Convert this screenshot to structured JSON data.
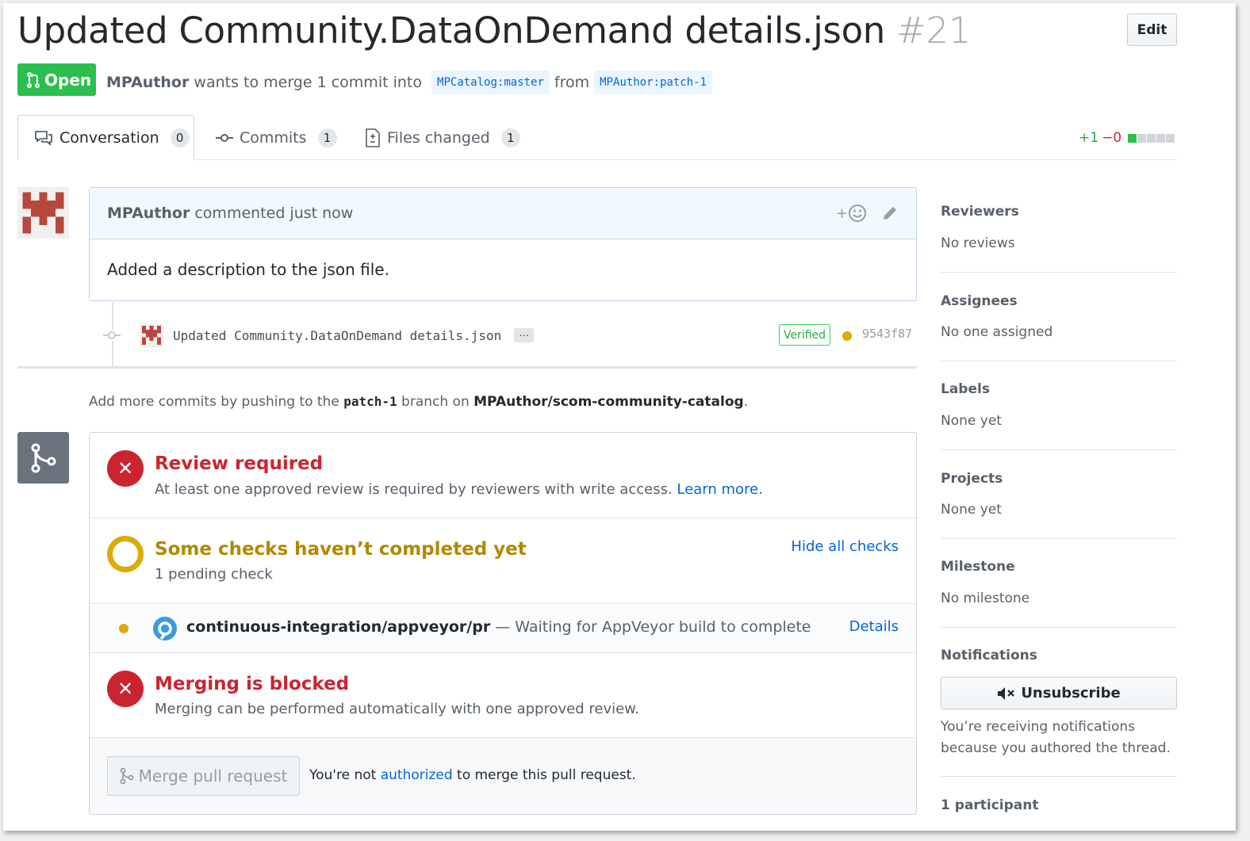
{
  "pr": {
    "title": "Updated Community.DataOnDemand details.json",
    "number": "#21",
    "edit_label": "Edit",
    "state_label": "Open",
    "author": "MPAuthor",
    "merge_text": "wants to merge 1 commit into",
    "base_branch": "MPCatalog:master",
    "from_text": "from",
    "head_branch": "MPAuthor:patch-1"
  },
  "tabs": [
    {
      "label": "Conversation",
      "count": "0",
      "icon": "comment-discussion-icon"
    },
    {
      "label": "Commits",
      "count": "1",
      "icon": "git-commit-icon"
    },
    {
      "label": "Files changed",
      "count": "1",
      "icon": "file-diff-icon"
    }
  ],
  "diffstat": {
    "added": "+1",
    "removed": "−0",
    "colors": {
      "added": "#28a745",
      "removed": "#cb2431"
    }
  },
  "comment": {
    "author": "MPAuthor",
    "action": "commented just now",
    "reaction_label": "+",
    "body": "Added a description to the json file."
  },
  "commit": {
    "message": "Updated Community.DataOnDemand details.json",
    "ellipsis": "…",
    "verified_label": "Verified",
    "sha": "9543f87"
  },
  "push_note": {
    "prefix": "Add more commits by pushing to the",
    "branch": "patch-1",
    "middle": "branch on",
    "repo": "MPAuthor/scom-community-catalog",
    "suffix": "."
  },
  "mergebox": {
    "review": {
      "title": "Review required",
      "desc": "At least one approved review is required by reviewers with write access.",
      "link": "Learn more."
    },
    "checks": {
      "title": "Some checks haven’t completed yet",
      "desc": "1 pending check",
      "toggle": "Hide all checks"
    },
    "check_item": {
      "name": "continuous-integration/appveyor/pr",
      "status": "— Waiting for AppVeyor build to complete",
      "details": "Details"
    },
    "blocked": {
      "title": "Merging is blocked",
      "desc": "Merging can be performed automatically with one approved review."
    },
    "merge_button": "Merge pull request",
    "not_auth_prefix": "You're not",
    "not_auth_link": "authorized",
    "not_auth_suffix": "to merge this pull request."
  },
  "sidebar": {
    "reviewers": {
      "heading": "Reviewers",
      "value": "No reviews"
    },
    "assignees": {
      "heading": "Assignees",
      "value": "No one assigned"
    },
    "labels": {
      "heading": "Labels",
      "value": "None yet"
    },
    "projects": {
      "heading": "Projects",
      "value": "None yet"
    },
    "milestone": {
      "heading": "Milestone",
      "value": "No milestone"
    },
    "notifications": {
      "heading": "Notifications",
      "button": "Unsubscribe",
      "text": "You’re receiving notifications because you authored the thread."
    },
    "participants": "1 participant"
  }
}
